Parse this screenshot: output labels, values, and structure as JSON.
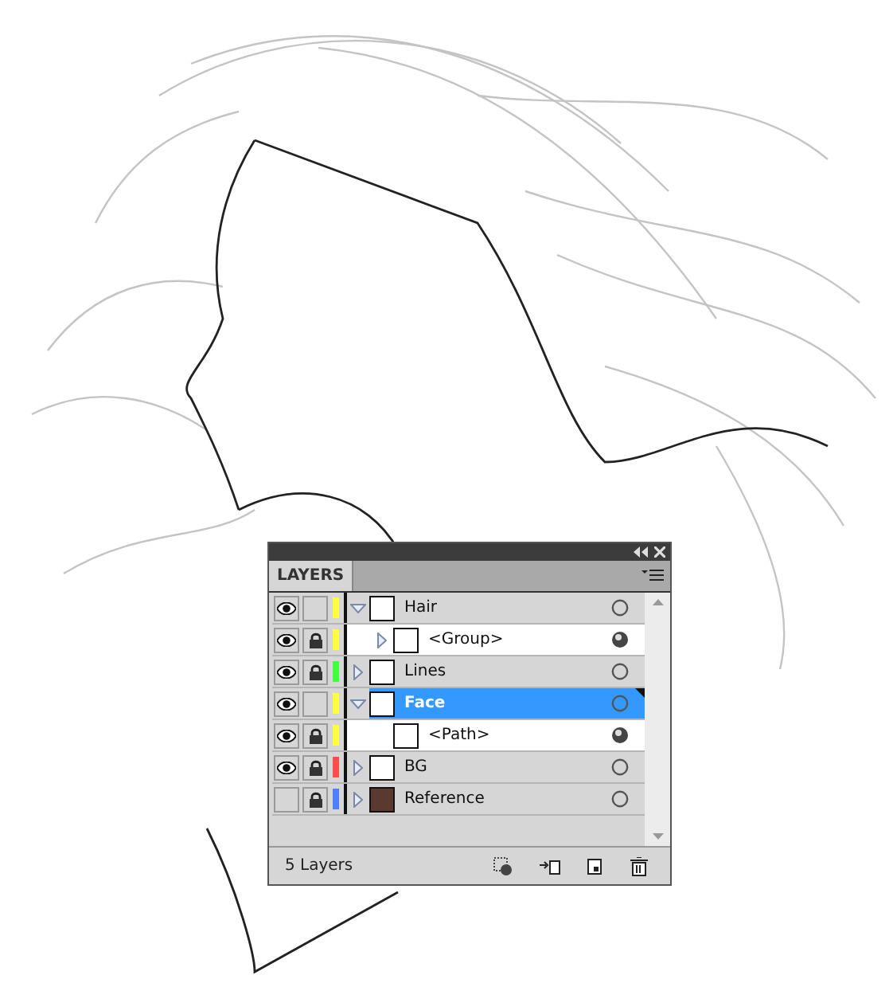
{
  "panel": {
    "tab": "LAYERS",
    "layers": [
      {
        "name": "Hair",
        "kind": "layer",
        "visible": true,
        "locked": false,
        "color": "#ffff40",
        "expanded": true,
        "selected": false,
        "children": [
          {
            "name": "<Group>",
            "kind": "object",
            "visible": true,
            "locked": true,
            "color": "#ffff40",
            "expanded": false,
            "selected": false
          }
        ]
      },
      {
        "name": "Lines",
        "kind": "layer",
        "visible": true,
        "locked": true,
        "color": "#40ff40",
        "expanded": false,
        "selected": false
      },
      {
        "name": "Face",
        "kind": "layer",
        "visible": true,
        "locked": false,
        "color": "#ffff40",
        "expanded": true,
        "selected": true,
        "children": [
          {
            "name": "<Path>",
            "kind": "object",
            "visible": true,
            "locked": true,
            "color": "#ffff40",
            "selected": false
          }
        ]
      },
      {
        "name": "BG",
        "kind": "layer",
        "visible": true,
        "locked": true,
        "color": "#ff4d4d",
        "expanded": false,
        "selected": false
      },
      {
        "name": "Reference",
        "kind": "layer",
        "visible": false,
        "locked": true,
        "color": "#4d7fff",
        "expanded": false,
        "selected": false
      }
    ],
    "footer": "5 Layers"
  }
}
